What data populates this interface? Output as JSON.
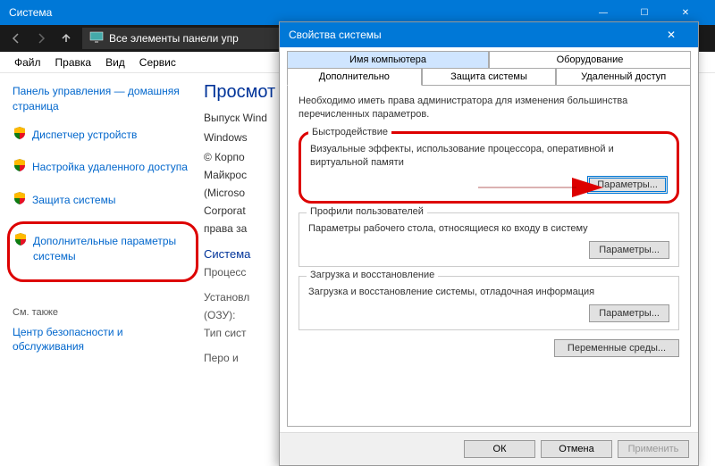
{
  "window": {
    "title": "Система",
    "breadcrumb": "Все элементы панели упр"
  },
  "menu": {
    "file": "Файл",
    "edit": "Правка",
    "view": "Вид",
    "tools": "Сервис"
  },
  "sidebar": {
    "home": "Панель управления — домашняя страница",
    "items": [
      {
        "label": "Диспетчер устройств"
      },
      {
        "label": "Настройка удаленного доступа"
      },
      {
        "label": "Защита системы"
      },
      {
        "label": "Дополнительные параметры системы"
      }
    ],
    "see_also": "См. также",
    "see_link": "Центр безопасности и обслуживания"
  },
  "content": {
    "heading": "Просмот",
    "row1": "Выпуск Wind",
    "row2": "Windows",
    "row3a": "© Корпо",
    "row3b": "Майкрос",
    "row3c": "(Microso",
    "row3d": "Corporat",
    "row3e": "права за",
    "grp1": "Система",
    "lbl1": "Процесс",
    "lbl2": "Установл",
    "lbl2b": "(ОЗУ):",
    "lbl3": "Тип сист",
    "lbl4": "Перо и"
  },
  "dialog": {
    "title": "Свойства системы",
    "tabs_top": {
      "name": "Имя компьютера",
      "hw": "Оборудование"
    },
    "tabs": {
      "adv": "Дополнительно",
      "prot": "Защита системы",
      "remote": "Удаленный доступ"
    },
    "intro": "Необходимо иметь права администратора для изменения большинства перечисленных параметров.",
    "perf": {
      "legend": "Быстродействие",
      "desc": "Визуальные эффекты, использование процессора, оперативной и виртуальной памяти",
      "btn": "Параметры..."
    },
    "profiles": {
      "legend": "Профили пользователей",
      "desc": "Параметры рабочего стола, относящиеся ко входу в систему",
      "btn": "Параметры..."
    },
    "startup": {
      "legend": "Загрузка и восстановление",
      "desc": "Загрузка и восстановление системы, отладочная информация",
      "btn": "Параметры..."
    },
    "envbtn": "Переменные среды...",
    "ok": "ОК",
    "cancel": "Отмена",
    "apply": "Применить"
  }
}
